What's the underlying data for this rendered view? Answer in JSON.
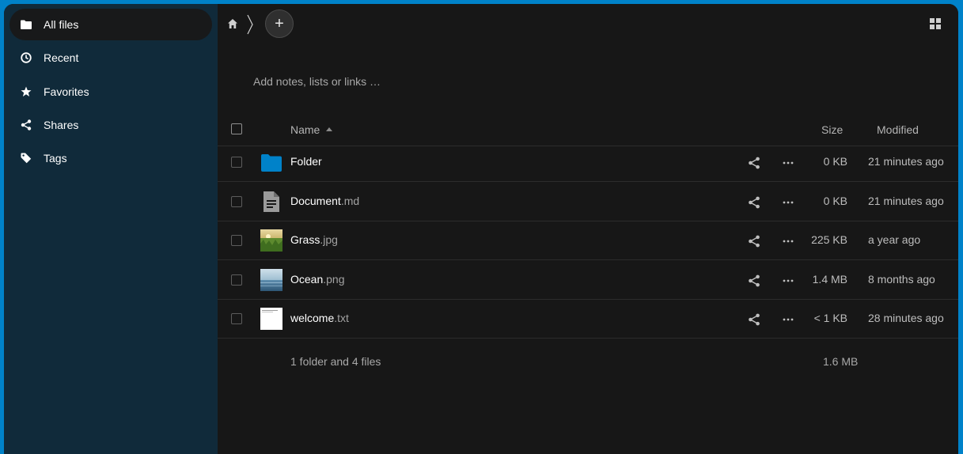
{
  "sidebar": {
    "items": [
      {
        "label": "All files",
        "icon": "folder-icon",
        "active": true
      },
      {
        "label": "Recent",
        "icon": "clock-icon"
      },
      {
        "label": "Favorites",
        "icon": "star-icon"
      },
      {
        "label": "Shares",
        "icon": "share-icon"
      },
      {
        "label": "Tags",
        "icon": "tag-icon"
      }
    ]
  },
  "toolbar": {
    "add_symbol": "+",
    "home_icon": "home-icon",
    "view_toggle_icon": "grid-view-icon"
  },
  "notes_placeholder": "Add notes, lists or links …",
  "table": {
    "headers": {
      "name": "Name",
      "size": "Size",
      "modified": "Modified"
    },
    "files": [
      {
        "base": "Folder",
        "ext": "",
        "size": "0 KB",
        "modified": "21 minutes ago",
        "type": "folder"
      },
      {
        "base": "Document",
        "ext": ".md",
        "size": "0 KB",
        "modified": "21 minutes ago",
        "type": "document"
      },
      {
        "base": "Grass",
        "ext": ".jpg",
        "size": "225 KB",
        "modified": "a year ago",
        "type": "image-grass"
      },
      {
        "base": "Ocean",
        "ext": ".png",
        "size": "1.4 MB",
        "modified": "8 months ago",
        "type": "image-ocean"
      },
      {
        "base": "welcome",
        "ext": ".txt",
        "size": "< 1 KB",
        "modified": "28 minutes ago",
        "type": "text"
      }
    ],
    "summary": {
      "count": "1 folder and 4 files",
      "size": "1.6 MB"
    }
  },
  "colors": {
    "brand": "#0082c9",
    "sidebar": "#102a3a",
    "main": "#171717",
    "folder": "#0082c9"
  }
}
